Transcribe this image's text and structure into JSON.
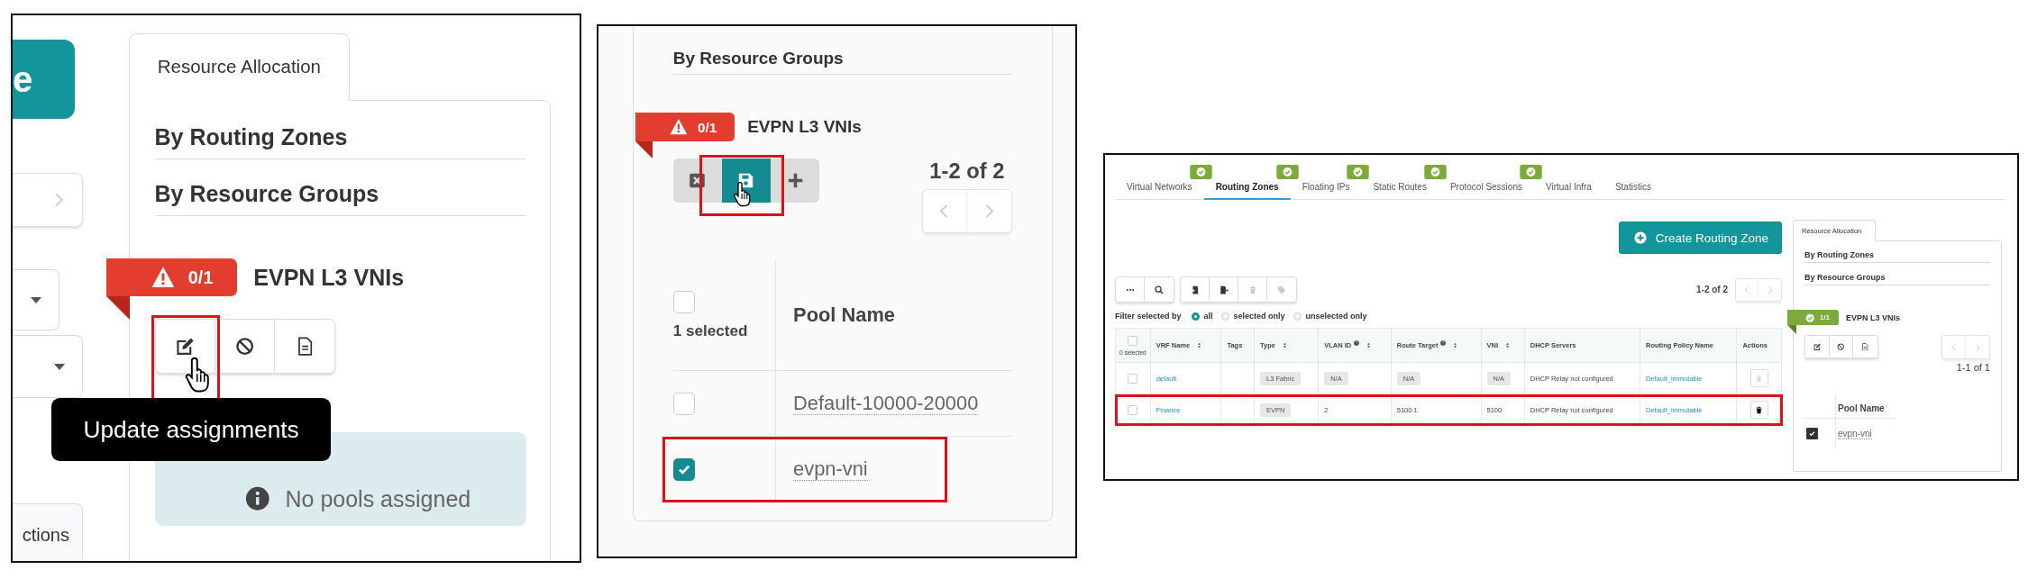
{
  "screenshots": [
    {
      "kind": "edit_tooltip",
      "side_button": "e",
      "side_tab": "ctions",
      "allocation": {
        "tab": "Resource Allocation",
        "sections": [
          "By Routing Zones",
          "By Resource Groups"
        ],
        "group": {
          "kind": "warning",
          "count": "0/1",
          "name": "EVPN L3 VNIs"
        },
        "tools": [
          {
            "kind": "edit",
            "highlighted": true
          },
          {
            "kind": "block",
            "highlighted": false
          },
          {
            "kind": "file",
            "highlighted": false
          }
        ],
        "tooltip": "Update assignments",
        "message": "No pools assigned"
      }
    },
    {
      "kind": "pool_selection",
      "allocation": {
        "sections": [
          "By Resource Groups"
        ],
        "group": {
          "kind": "warning",
          "count": "0/1",
          "name": "EVPN L3 VNIs"
        },
        "tools": [
          {
            "kind": "discard",
            "active": false,
            "highlighted": false
          },
          {
            "kind": "save",
            "active": true,
            "highlighted": true
          },
          {
            "kind": "add",
            "active": false,
            "highlighted": false
          }
        ],
        "pager": "1-2 of 2",
        "all_checked": false,
        "selected_count": "1 selected",
        "column": "Pool Name",
        "rows": [
          {
            "name": "Default-10000-20000",
            "checked": false,
            "highlighted": false
          },
          {
            "name": "evpn-vni",
            "checked": true,
            "highlighted": true
          }
        ]
      }
    },
    {
      "kind": "routing_zones",
      "tabs": [
        {
          "label": "Virtual Networks",
          "selected": false,
          "ok": true
        },
        {
          "label": "Routing Zones",
          "selected": true,
          "ok": true
        },
        {
          "label": "Floating IPs",
          "selected": false,
          "ok": true
        },
        {
          "label": "Static Routes",
          "selected": false,
          "ok": true
        },
        {
          "label": "Protocol Sessions",
          "selected": false,
          "ok": true
        },
        {
          "label": "Virtual Infra",
          "selected": false,
          "ok": false
        },
        {
          "label": "Statistics",
          "selected": false,
          "ok": false
        }
      ],
      "create_button": "Create Routing Zone",
      "tools": [
        [
          {
            "kind": "more",
            "disabled": false
          },
          {
            "kind": "search",
            "disabled": false
          }
        ],
        [
          {
            "kind": "import",
            "disabled": false
          },
          {
            "kind": "export",
            "disabled": false
          },
          {
            "kind": "trash",
            "disabled": true
          },
          {
            "kind": "tag",
            "disabled": true
          }
        ]
      ],
      "pager": "1-2 of 2",
      "filter": {
        "label": "Filter selected by",
        "options": [
          {
            "label": "all",
            "selected": true
          },
          {
            "label": "selected only",
            "selected": false
          },
          {
            "label": "unselected only",
            "selected": false
          }
        ]
      },
      "table": {
        "all_checked": false,
        "selected_count": "0 selected",
        "columns": [
          {
            "label": "VRF Name",
            "sortable": true,
            "help": false
          },
          {
            "label": "Tags",
            "sortable": false,
            "help": false
          },
          {
            "label": "Type",
            "sortable": true,
            "help": false
          },
          {
            "label": "VLAN ID",
            "sortable": true,
            "help": true
          },
          {
            "label": "Route Target",
            "sortable": true,
            "help": true
          },
          {
            "label": "VNI",
            "sortable": true,
            "help": false
          },
          {
            "label": "DHCP Servers",
            "sortable": false,
            "help": false
          },
          {
            "label": "Routing Policy Name",
            "sortable": false,
            "help": false
          },
          {
            "label": "Actions",
            "sortable": false,
            "help": false
          }
        ],
        "rows": [
          {
            "checked": false,
            "highlighted": false,
            "cells": [
              {
                "kind": "link",
                "text": "default"
              },
              {
                "kind": "empty"
              },
              {
                "kind": "tag",
                "text": "L3 Fabric"
              },
              {
                "kind": "tag",
                "text": "N/A"
              },
              {
                "kind": "tag",
                "text": "N/A"
              },
              {
                "kind": "tag",
                "text": "N/A"
              },
              {
                "kind": "text",
                "text": "DHCP Relay not configured"
              },
              {
                "kind": "link",
                "text": "Default_immutable"
              },
              {
                "kind": "delete",
                "disabled": true
              }
            ]
          },
          {
            "checked": false,
            "highlighted": true,
            "cells": [
              {
                "kind": "link",
                "text": "Finance"
              },
              {
                "kind": "empty"
              },
              {
                "kind": "tag",
                "text": "EVPN"
              },
              {
                "kind": "text",
                "text": "2"
              },
              {
                "kind": "text",
                "text": "5100:1"
              },
              {
                "kind": "text",
                "text": "5100"
              },
              {
                "kind": "text",
                "text": "DHCP Relay not configured"
              },
              {
                "kind": "link",
                "text": "Default_immutable"
              },
              {
                "kind": "delete",
                "disabled": false
              }
            ]
          }
        ]
      },
      "allocation": {
        "tab": "Resource Allocation",
        "sections": [
          "By Routing Zones",
          "By Resource Groups"
        ],
        "group": {
          "kind": "ok",
          "count": "1/1",
          "name": "EVPN L3 VNIs"
        },
        "tools": [
          {
            "kind": "edit"
          },
          {
            "kind": "block"
          },
          {
            "kind": "file"
          }
        ],
        "pager": "1-1 of 1",
        "column": "Pool Name",
        "rows": [
          {
            "name": "evpn-vni",
            "checked": true
          }
        ]
      }
    }
  ]
}
